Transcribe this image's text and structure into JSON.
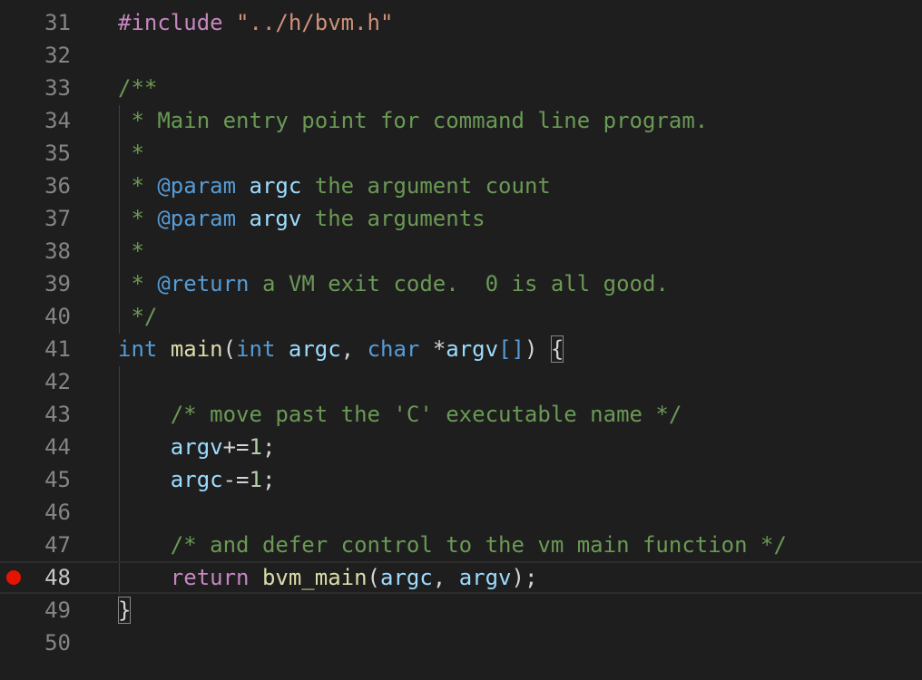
{
  "colors": {
    "background": "#1e1e1e",
    "line_number": "#858585",
    "breakpoint": "#e51400",
    "comment": "#6a9955",
    "keyword": "#569cd6",
    "preprocessor": "#c586c0",
    "string": "#ce9178",
    "variable": "#9cdcfe",
    "function": "#dcdcaa",
    "number": "#b5cea8"
  },
  "editor": {
    "current_line": 48,
    "breakpoint_line": 48,
    "lines": [
      {
        "n": "31",
        "tokens": [
          [
            "pp",
            "#include "
          ],
          [
            "str",
            "\"../h/bvm.h\""
          ]
        ]
      },
      {
        "n": "32",
        "tokens": []
      },
      {
        "n": "33",
        "tokens": [
          [
            "cmt",
            "/**"
          ]
        ]
      },
      {
        "n": "34",
        "tokens": [
          [
            "cmt",
            " * Main entry point for command line program."
          ]
        ]
      },
      {
        "n": "35",
        "tokens": [
          [
            "cmt",
            " *"
          ]
        ]
      },
      {
        "n": "36",
        "tokens": [
          [
            "cmt",
            " * "
          ],
          [
            "tag",
            "@param"
          ],
          [
            "cmt",
            " "
          ],
          [
            "var",
            "argc"
          ],
          [
            "cmt",
            " the argument count"
          ]
        ]
      },
      {
        "n": "37",
        "tokens": [
          [
            "cmt",
            " * "
          ],
          [
            "tag",
            "@param"
          ],
          [
            "cmt",
            " "
          ],
          [
            "var",
            "argv"
          ],
          [
            "cmt",
            " the arguments"
          ]
        ]
      },
      {
        "n": "38",
        "tokens": [
          [
            "cmt",
            " *"
          ]
        ]
      },
      {
        "n": "39",
        "tokens": [
          [
            "cmt",
            " * "
          ],
          [
            "tag",
            "@return"
          ],
          [
            "cmt",
            " a VM exit code.  0 is all good."
          ]
        ]
      },
      {
        "n": "40",
        "tokens": [
          [
            "cmt",
            " */"
          ]
        ]
      },
      {
        "n": "41",
        "tokens": [
          [
            "kw",
            "int"
          ],
          [
            "op",
            " "
          ],
          [
            "fn",
            "main"
          ],
          [
            "op",
            "("
          ],
          [
            "kw",
            "int"
          ],
          [
            "op",
            " "
          ],
          [
            "var",
            "argc"
          ],
          [
            "op",
            ", "
          ],
          [
            "kw",
            "char"
          ],
          [
            "op",
            " *"
          ],
          [
            "var",
            "argv"
          ],
          [
            "br",
            "[]"
          ],
          [
            "op",
            ") "
          ],
          [
            "box",
            "{"
          ]
        ]
      },
      {
        "n": "42",
        "tokens": []
      },
      {
        "n": "43",
        "tokens": [
          [
            "op",
            "    "
          ],
          [
            "cmt",
            "/* move past the 'C' executable name */"
          ]
        ]
      },
      {
        "n": "44",
        "tokens": [
          [
            "op",
            "    "
          ],
          [
            "var",
            "argv"
          ],
          [
            "op",
            "+="
          ],
          [
            "num",
            "1"
          ],
          [
            "op",
            ";"
          ]
        ]
      },
      {
        "n": "45",
        "tokens": [
          [
            "op",
            "    "
          ],
          [
            "var",
            "argc"
          ],
          [
            "op",
            "-="
          ],
          [
            "num",
            "1"
          ],
          [
            "op",
            ";"
          ]
        ]
      },
      {
        "n": "46",
        "tokens": []
      },
      {
        "n": "47",
        "tokens": [
          [
            "op",
            "    "
          ],
          [
            "cmt",
            "/* and defer control to the vm main function */"
          ]
        ]
      },
      {
        "n": "48",
        "tokens": [
          [
            "op",
            "    "
          ],
          [
            "ctrl",
            "return"
          ],
          [
            "op",
            " "
          ],
          [
            "fn",
            "bvm_main"
          ],
          [
            "op",
            "("
          ],
          [
            "var",
            "argc"
          ],
          [
            "op",
            ", "
          ],
          [
            "var",
            "argv"
          ],
          [
            "op",
            ");"
          ]
        ]
      },
      {
        "n": "49",
        "tokens": [
          [
            "box",
            "}"
          ]
        ]
      },
      {
        "n": "50",
        "tokens": []
      }
    ]
  }
}
